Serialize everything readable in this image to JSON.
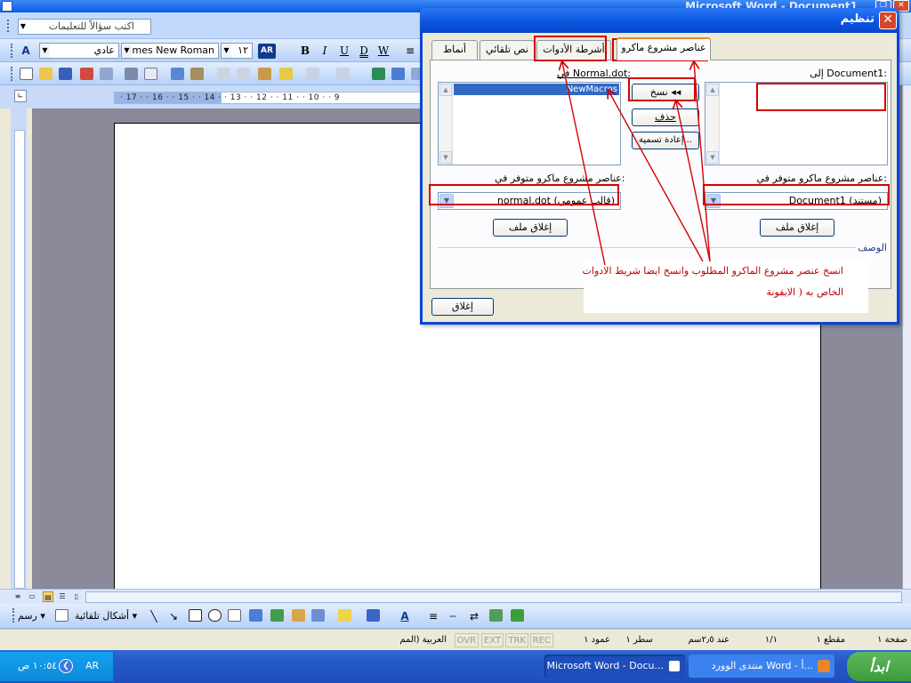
{
  "window": {
    "title": "Microsoft Word - Document1",
    "help_placeholder": "اكتب سؤالاً للتعليمات"
  },
  "formatting": {
    "style": "عادي",
    "font": "Times New Roman",
    "size": "١٢",
    "direction_badge": "AR",
    "bold": "B",
    "italic": "I",
    "underline": "U",
    "double_underline": "D",
    "word_underline": "W"
  },
  "ruler": {
    "text": "· 17 · · 16 · · 15 · · 14 · · 13 · · 12 · · 11 · · 10 · · 9"
  },
  "dialog": {
    "title": "تنظيم",
    "tabs": [
      {
        "label": "عناصر مشروع ماكرو",
        "active": true
      },
      {
        "label": "أشرطة الأدوات",
        "active": false
      },
      {
        "label": "نص تلقائي",
        "active": false
      },
      {
        "label": "أنماط",
        "active": false
      }
    ],
    "right_label": "إلى Document1:",
    "left_label": "في Normal.dot:",
    "left_list": [
      "NewMacros"
    ],
    "copy_button": "نسخ ◂◂",
    "delete_button": "حذف",
    "rename_button": "إعادة تسمية...",
    "right_available_label": "عناصر مشروع ماكرو متوفر في:",
    "left_available_label": "عناصر مشروع ماكرو متوفر في:",
    "right_combo_value": "Document1 (مستند)",
    "left_combo_value": "normal.dot (قالب عمومي)",
    "right_close_file": "إغلاق ملف",
    "left_close_file": "إغلاق ملف",
    "description_label": "الوصف",
    "close_button": "إغلاق"
  },
  "annotation": {
    "line1": "انسخ عنصر مشروع الماكرو المطلوب وانسخ ايضا شريط الادوات",
    "line2": "الخاص به ( الايقونة"
  },
  "drawing_toolbar": {
    "draw_label": "رسم ▾",
    "autoshapes_label": "أشكال تلقائية ▾"
  },
  "status_bar": {
    "page": "صفحة ١",
    "section": "مقطع ١",
    "pages": "١/١",
    "at": "عند ٢٫٥سم",
    "line": "سطر ١",
    "col": "عمود ١",
    "rec": "REC",
    "trk": "TRK",
    "ext": "EXT",
    "ovr": "OVR",
    "language": "العربية (المم"
  },
  "taskbar": {
    "start": "ابدأ",
    "task1": "منتدى الوورد Word - أ...",
    "task2": "Microsoft Word - Docu...",
    "lang": "AR",
    "clock": "١٠:٥٤ ص"
  },
  "colors": {
    "annotation_red": "#d50000",
    "xp_blue": "#0a52dd",
    "selection": "#316ac5"
  }
}
